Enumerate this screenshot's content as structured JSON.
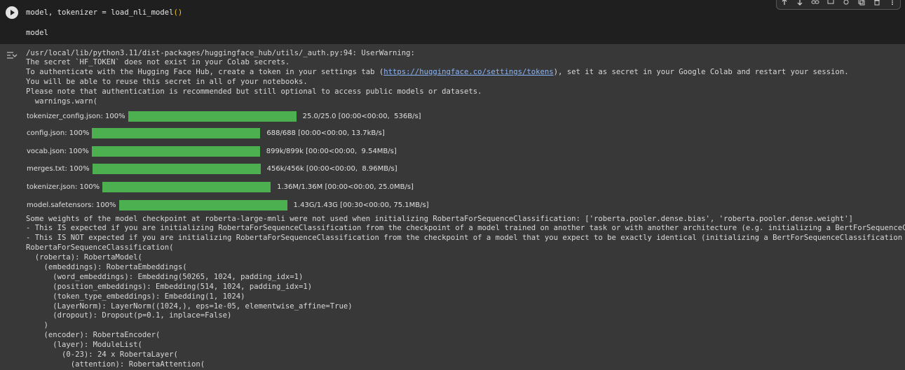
{
  "input_cell": {
    "code_line1_prefix": "model, tokenizer = load_nli_model",
    "code_line1_parens": "()",
    "code_line2": "model"
  },
  "colors": {
    "progress_fill": "#4caf50",
    "parens": "#f5c518",
    "link": "#8ab4f8"
  },
  "warning": {
    "line1": "/usr/local/lib/python3.11/dist-packages/huggingface_hub/utils/_auth.py:94: UserWarning:",
    "line2": "The secret `HF_TOKEN` does not exist in your Colab secrets.",
    "line3_pre": "To authenticate with the Hugging Face Hub, create a token in your settings tab (",
    "line3_link": "https://huggingface.co/settings/tokens",
    "line3_post": "), set it as secret in your Google Colab and restart your session.",
    "line4": "You will be able to reuse this secret in all of your notebooks.",
    "line5": "Please note that authentication is recommended but still optional to access public models or datasets.",
    "line6": "  warnings.warn("
  },
  "downloads": [
    {
      "name": "tokenizer_config.json: 100%",
      "progress": 1.0,
      "stats": "25.0/25.0 [00:00<00:00,  536B/s]"
    },
    {
      "name": "config.json: 100%",
      "progress": 1.0,
      "stats": "688/688 [00:00<00:00, 13.7kB/s]"
    },
    {
      "name": "vocab.json: 100%",
      "progress": 1.0,
      "stats": "899k/899k [00:00<00:00,  9.54MB/s]"
    },
    {
      "name": "merges.txt: 100%",
      "progress": 1.0,
      "stats": "456k/456k [00:00<00:00,  8.96MB/s]"
    },
    {
      "name": "tokenizer.json: 100%",
      "progress": 1.0,
      "stats": "1.36M/1.36M [00:00<00:00, 25.0MB/s]"
    },
    {
      "name": "model.safetensors: 100%",
      "progress": 1.0,
      "stats": "1.43G/1.43G [00:30<00:00, 75.1MB/s]"
    }
  ],
  "log_lines": [
    "Some weights of the model checkpoint at roberta-large-mnli were not used when initializing RobertaForSequenceClassification: ['roberta.pooler.dense.bias', 'roberta.pooler.dense.weight']",
    "- This IS expected if you are initializing RobertaForSequenceClassification from the checkpoint of a model trained on another task or with another architecture (e.g. initializing a BertForSequenceClassif",
    "- This IS NOT expected if you are initializing RobertaForSequenceClassification from the checkpoint of a model that you expect to be exactly identical (initializing a BertForSequenceClassification model",
    "RobertaForSequenceClassification(",
    "  (roberta): RobertaModel(",
    "    (embeddings): RobertaEmbeddings(",
    "      (word_embeddings): Embedding(50265, 1024, padding_idx=1)",
    "      (position_embeddings): Embedding(514, 1024, padding_idx=1)",
    "      (token_type_embeddings): Embedding(1, 1024)",
    "      (LayerNorm): LayerNorm((1024,), eps=1e-05, elementwise_affine=True)",
    "      (dropout): Dropout(p=0.1, inplace=False)",
    "    )",
    "    (encoder): RobertaEncoder(",
    "      (layer): ModuleList(",
    "        (0-23): 24 x RobertaLayer(",
    "          (attention): RobertaAttention("
  ]
}
